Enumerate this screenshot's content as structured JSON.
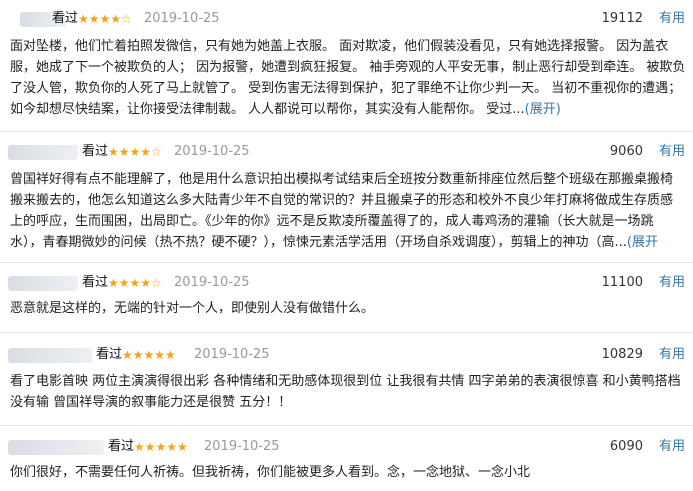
{
  "reviews": [
    {
      "watched": "看过",
      "stars": "★★★★☆",
      "date": "2019-10-25",
      "votes": "19112",
      "useful": "有用",
      "text": "面对坠楼，他们忙着拍照发微信，只有她为她盖上衣服。 面对欺凌，他们假装没看见，只有她选择报警。 因为盖衣\n服，她成了下一个被欺负的人； 因为报警，她遭到疯狂报复。 袖手旁观的人平安无事，制止恶行却受到牵连。 被欺负\n了没人管，欺负你的人死了马上就管了。 受到伤害无法得到保护，犯了罪绝不让你少判一天。 当初不重视你的遭遇；\n如今却想尽快结案，让你接受法律制裁。 人人都说可以帮你，其实没有人能帮你。 受过...",
      "expand": "(展开)"
    },
    {
      "watched": "看过",
      "stars": "★★★★☆",
      "date": "2019-10-25",
      "votes": "9060",
      "useful": "有用",
      "text": "曾国祥好得有点不能理解了，他是用什么意识拍出模拟考试结束后全班按分数重新排座位然后整个班级在那搬桌搬椅\n搬来搬去的，他怎么知道这么多大陆青少年不自觉的常识的？并且搬桌子的形态和校外不良少年打麻将做成生存质感\n上的呼应，生而围困，出局即亡。《少年的你》远不是反欺凌所覆盖得了的，成人毒鸡汤的灌输（长大就是一场跳\n水），青春期微妙的问候（热不热？硬不硬？），惊悚元素活学活用（开场自杀戏调度），剪辑上的神功（高...",
      "expand": "(展开"
    },
    {
      "watched": "看过",
      "stars": "★★★★☆",
      "date": "2019-10-25",
      "votes": "11100",
      "useful": "有用",
      "text": "恶意就是这样的，无端的针对一个人，即使别人没有做错什么。",
      "expand": ""
    },
    {
      "watched": "看过",
      "stars": "★★★★★",
      "date": "2019-10-25",
      "votes": "10829",
      "useful": "有用",
      "text": "看了电影首映 两位主演演得很出彩 各种情绪和无助感体现很到位 让我很有共情 四字弟弟的表演很惊喜 和小黄鸭搭档\n没有输 曾国祥导演的叙事能力还是很赞 五分！！",
      "expand": ""
    },
    {
      "watched": "看过",
      "stars": "★★★★★",
      "date": "2019-10-25",
      "votes": "6090",
      "useful": "有用",
      "text": "你们很好，不需要任何人祈祷。但我祈祷，你们能被更多人看到。念，一念地狱、一念小北",
      "expand": ""
    }
  ]
}
